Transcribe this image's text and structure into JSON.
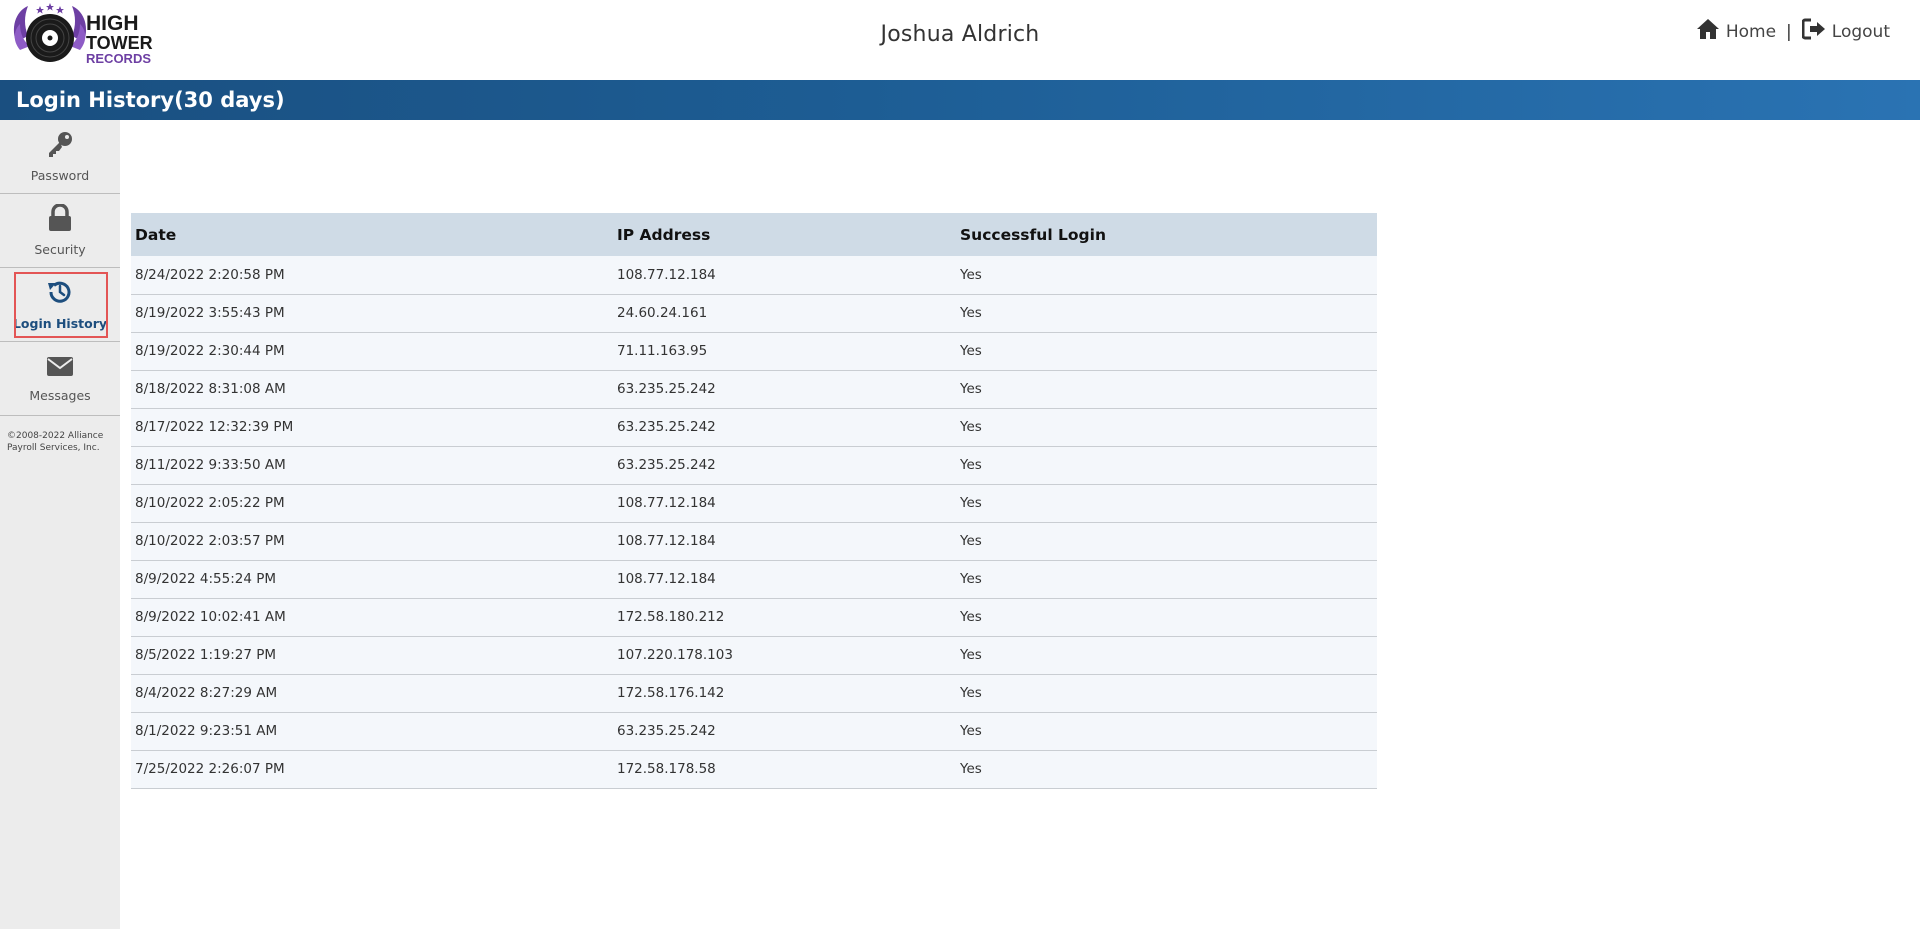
{
  "header": {
    "logo": {
      "line1": "HIGH",
      "line2": "TOWER",
      "line3": "RECORDS"
    },
    "user_name": "Joshua Aldrich",
    "nav": {
      "home_label": "Home",
      "separator": "|",
      "logout_label": "Logout"
    }
  },
  "page": {
    "title": "Login History(30 days)"
  },
  "sidebar": {
    "items": [
      {
        "label": "Password",
        "icon": "key-icon"
      },
      {
        "label": "Security",
        "icon": "lock-icon"
      },
      {
        "label": "Login History",
        "icon": "history-icon",
        "active": true
      },
      {
        "label": "Messages",
        "icon": "envelope-icon"
      }
    ],
    "copyright": "©2008-2022 Alliance Payroll Services, Inc."
  },
  "table": {
    "columns": [
      "Date",
      "IP Address",
      "Successful Login"
    ],
    "rows": [
      [
        "8/24/2022 2:20:58 PM",
        "108.77.12.184",
        "Yes"
      ],
      [
        "8/19/2022 3:55:43 PM",
        "24.60.24.161",
        "Yes"
      ],
      [
        "8/19/2022 2:30:44 PM",
        "71.11.163.95",
        "Yes"
      ],
      [
        "8/18/2022 8:31:08 AM",
        "63.235.25.242",
        "Yes"
      ],
      [
        "8/17/2022 12:32:39 PM",
        "63.235.25.242",
        "Yes"
      ],
      [
        "8/11/2022 9:33:50 AM",
        "63.235.25.242",
        "Yes"
      ],
      [
        "8/10/2022 2:05:22 PM",
        "108.77.12.184",
        "Yes"
      ],
      [
        "8/10/2022 2:03:57 PM",
        "108.77.12.184",
        "Yes"
      ],
      [
        "8/9/2022 4:55:24 PM",
        "108.77.12.184",
        "Yes"
      ],
      [
        "8/9/2022 10:02:41 AM",
        "172.58.180.212",
        "Yes"
      ],
      [
        "8/5/2022 1:19:27 PM",
        "107.220.178.103",
        "Yes"
      ],
      [
        "8/4/2022 8:27:29 AM",
        "172.58.176.142",
        "Yes"
      ],
      [
        "8/1/2022 9:23:51 AM",
        "63.235.25.242",
        "Yes"
      ],
      [
        "7/25/2022 2:26:07 PM",
        "172.58.178.58",
        "Yes"
      ]
    ]
  },
  "colors": {
    "title_bar": "#1d5d94",
    "header_row": "#cfdbe6",
    "row_bg": "#f4f7fb",
    "active_highlight": "#e35555",
    "logo_purple": "#6d3fa3"
  }
}
